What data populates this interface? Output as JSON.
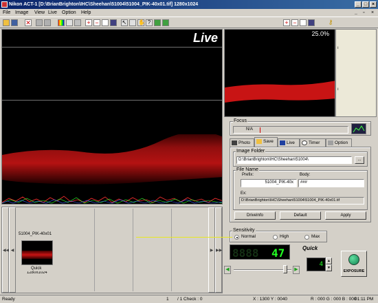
{
  "window": {
    "title": "Nikon ACT-1   [D:\\BrianBrighton\\IHC\\Sheehan\\51004\\51004_PIK-40x01.tif] 1280x1024"
  },
  "menu": [
    "File",
    "Image",
    "View",
    "Live",
    "Option",
    "Help"
  ],
  "live": {
    "label": "Live"
  },
  "preview": {
    "zoom": "25.0%"
  },
  "thumbnails": {
    "item_name": "51004_PIK-40x01",
    "quality": "Quick",
    "size": "1280x1024"
  },
  "focus": {
    "title": "Focus",
    "value": "N/A"
  },
  "tabs": [
    "Photo",
    "Save",
    "Live",
    "Timer",
    "Option"
  ],
  "save": {
    "image_folder_label": "Image Folder",
    "image_folder_value": "D:\\BrianBrighton\\IHC\\Sheehan\\51004\\",
    "browse_label": "...",
    "file_name_label": "File Name",
    "prefix_label": "Prefix:",
    "prefix_value": "51004_PIK-40x",
    "body_label": "Body:",
    "body_value": "###",
    "example_label": "Ex:",
    "example_value": "D:\\BrianBrighton\\IHC\\Sheehan\\51004\\51004_PIK-40x01.tif",
    "driveinfo_label": "DriveInfo",
    "default_label": "Default",
    "apply_label": "Apply"
  },
  "sensitivity": {
    "title": "Sensitivity",
    "options": [
      "Normal",
      "High",
      "Max"
    ],
    "selected": "Normal"
  },
  "exposure": {
    "display": "8888",
    "display_active": "47",
    "mode": "Quick",
    "counter": "4",
    "button_label": "EXPOSURE"
  },
  "status": {
    "ready": "Ready",
    "page": "1",
    "of": "/   1 Check : 0",
    "coords": "X : 1300   Y : 0040",
    "rgb": "R : 000   G : 000   B : 000",
    "time": "01:11 PM"
  },
  "colors": {
    "accent": "#0a246a",
    "tissue": "#c81414",
    "led": "#22ff22"
  }
}
